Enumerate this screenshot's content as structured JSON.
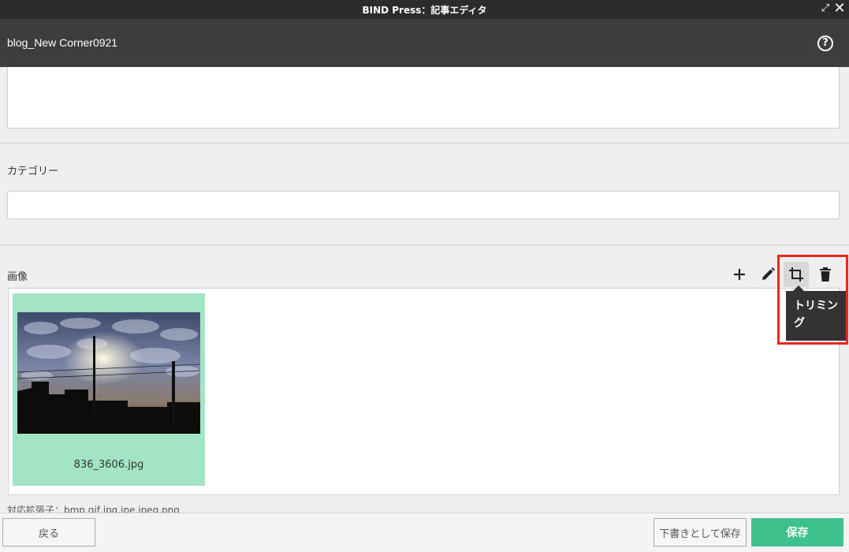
{
  "window": {
    "title": "BIND Press：記事エディタ",
    "expand_icon": "expand-icon",
    "close_icon": "close-icon"
  },
  "header": {
    "page_title": "blog_New Corner0921",
    "help_icon": "question-circle-icon",
    "help_glyph": "?"
  },
  "category": {
    "label": "カテゴリー",
    "value": ""
  },
  "image_section": {
    "label": "画像",
    "tools": [
      {
        "name": "add",
        "icon": "plus-icon"
      },
      {
        "name": "edit",
        "icon": "pencil-icon"
      },
      {
        "name": "crop",
        "icon": "crop-icon",
        "active": true
      },
      {
        "name": "delete",
        "icon": "trash-icon"
      }
    ],
    "tooltip": "トリミング",
    "image": {
      "filename": "836_3606.jpg",
      "selected": true,
      "selected_color": "#a3e4c5"
    },
    "supported_extensions": "対応拡張子：bmp,gif,jpg,jpe,jpeg,png"
  },
  "footer": {
    "back_label": "戻る",
    "draft_label": "下書きとして保存",
    "save_label": "保存",
    "save_color": "#3ec18c"
  },
  "annotation": {
    "highlight_color": "#e8291c"
  }
}
